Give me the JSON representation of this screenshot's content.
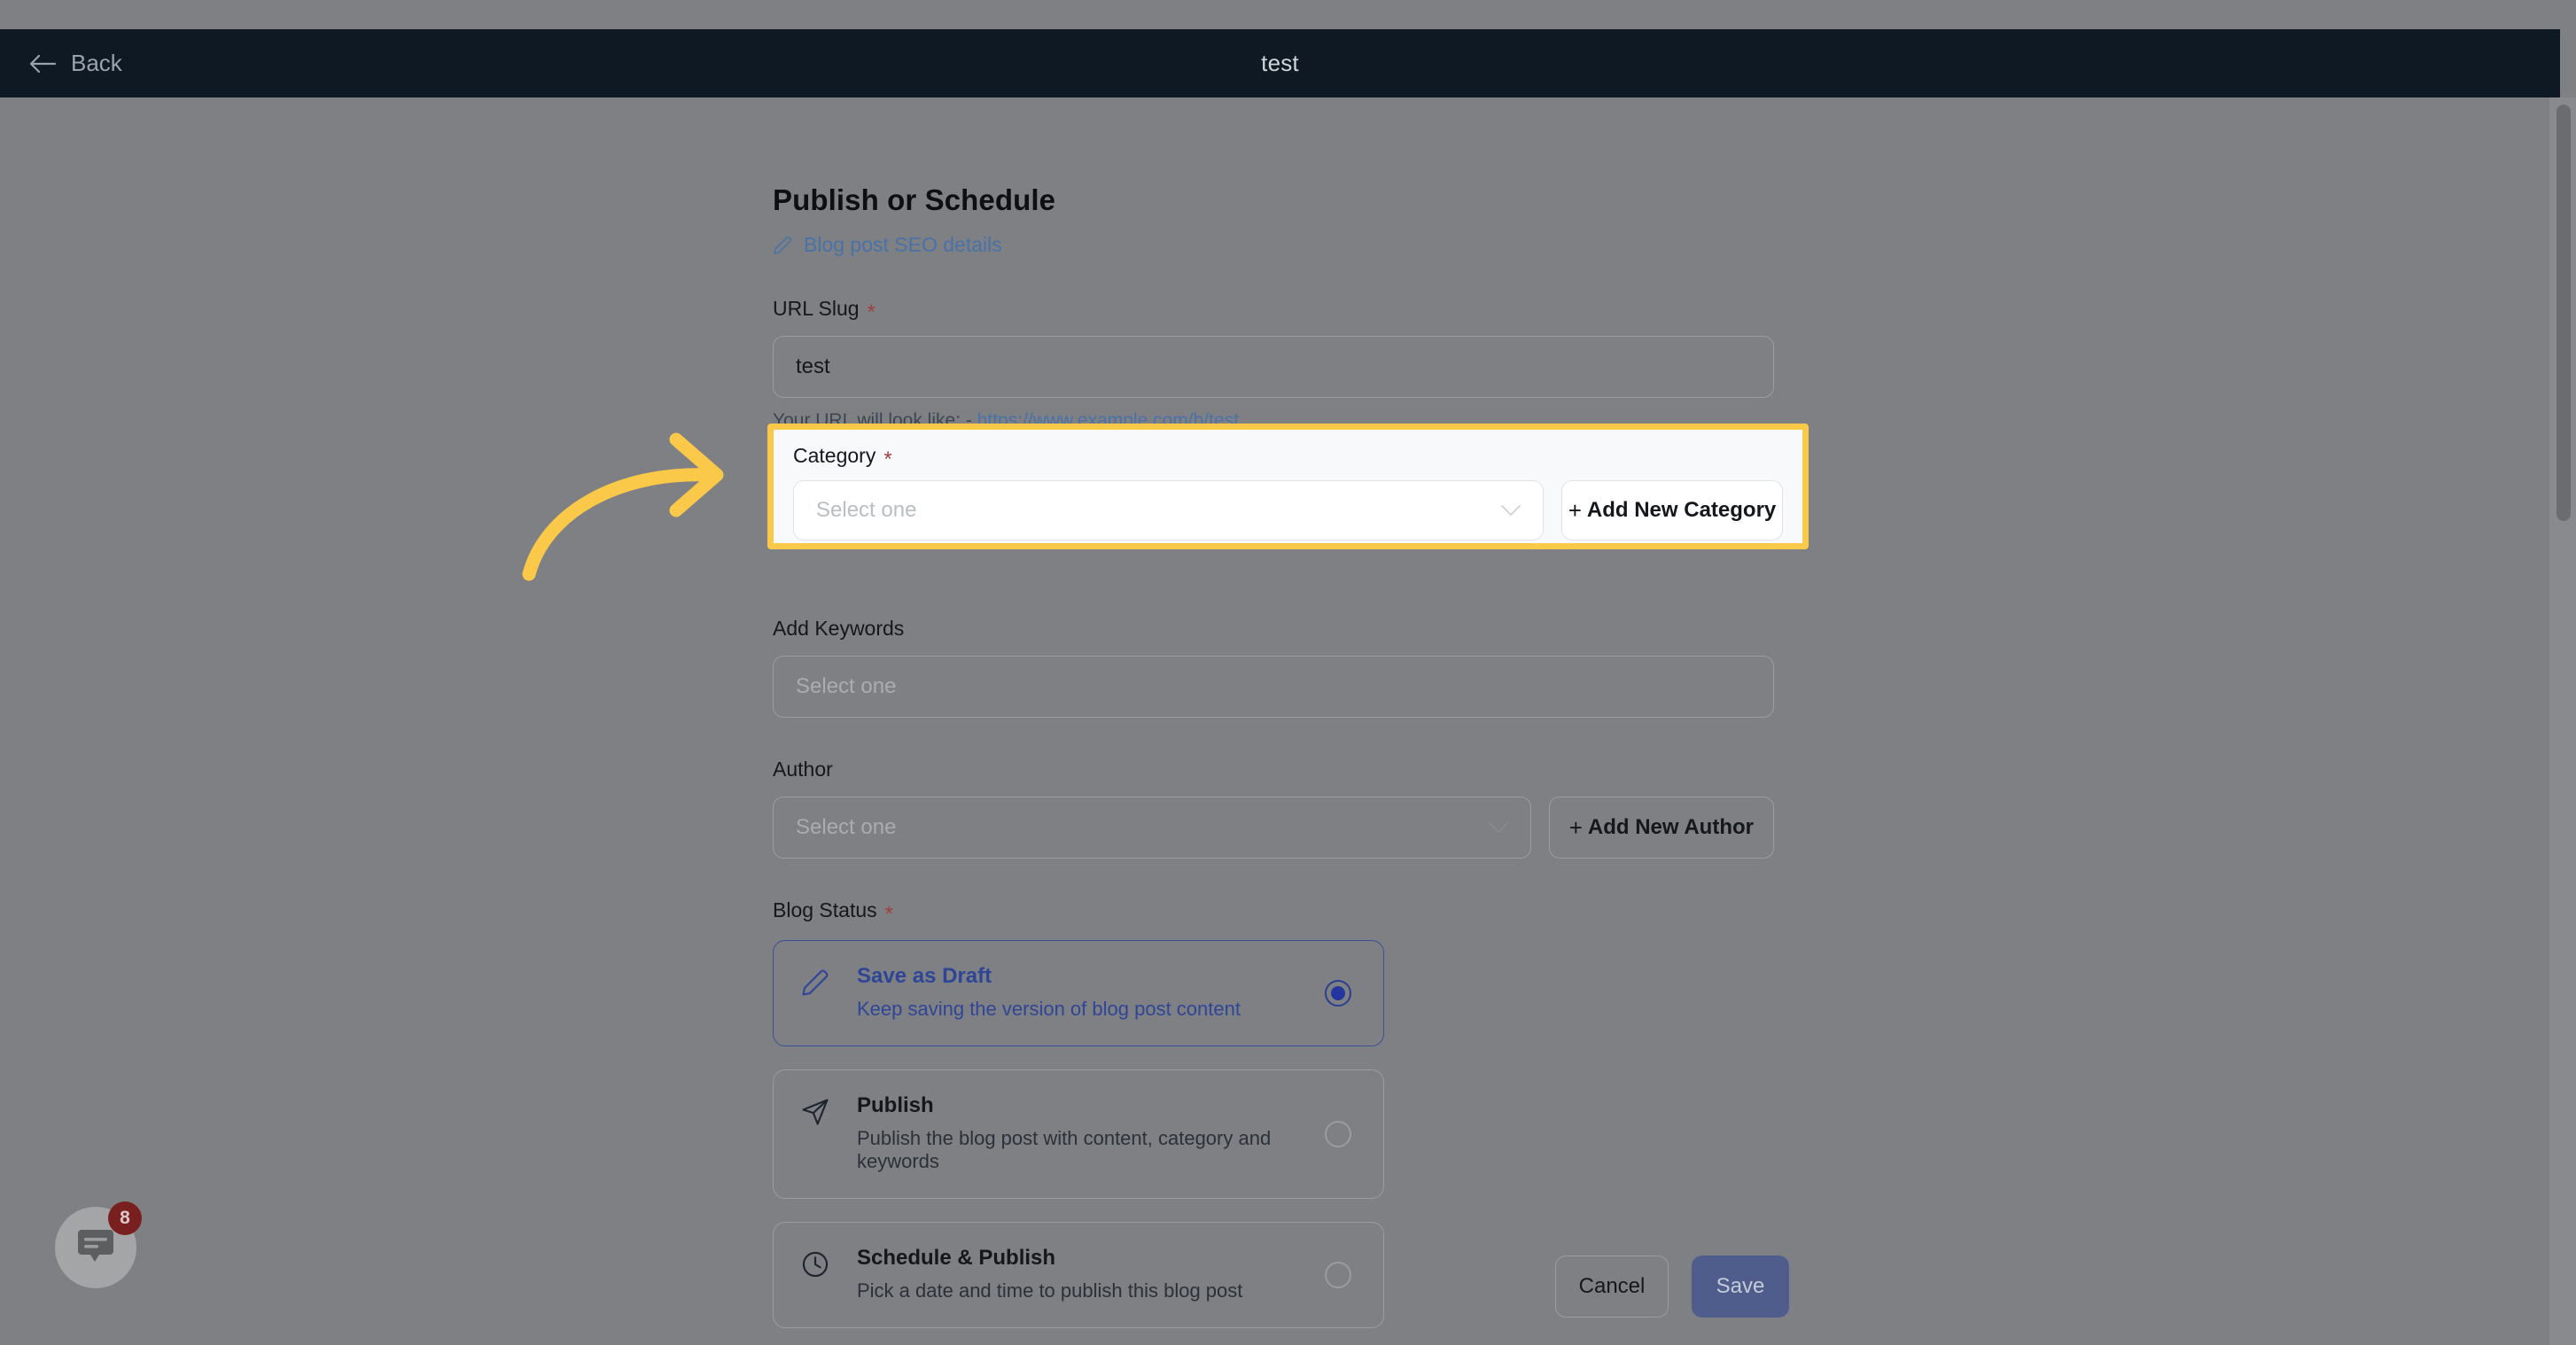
{
  "topbar": {
    "back_label": "Back",
    "title": "test"
  },
  "page": {
    "heading": "Publish or Schedule",
    "seo_link": "Blog post SEO details"
  },
  "url_slug": {
    "label": "URL Slug",
    "required_mark": "*",
    "value": "test",
    "helper_prefix": "Your URL will look like: - ",
    "helper_url": "https://www.example.com/b/test"
  },
  "category": {
    "label": "Category",
    "required_mark": "*",
    "placeholder": "Select one",
    "add_button": "Add New Category",
    "plus": "+",
    "highlighted": true
  },
  "keywords": {
    "label": "Add Keywords",
    "placeholder": "Select one"
  },
  "author": {
    "label": "Author",
    "placeholder": "Select one",
    "add_button": "Add New Author",
    "plus": "+"
  },
  "blog_status": {
    "label": "Blog Status",
    "required_mark": "*",
    "options": [
      {
        "icon": "pencil-icon",
        "title": "Save as Draft",
        "description": "Keep saving the version of blog post content",
        "selected": true
      },
      {
        "icon": "paper-plane-icon",
        "title": "Publish",
        "description": "Publish the blog post with content, category and keywords",
        "selected": false
      },
      {
        "icon": "clock-icon",
        "title": "Schedule & Publish",
        "description": "Pick a date and time to publish this blog post",
        "selected": false
      }
    ]
  },
  "footer": {
    "cancel_label": "Cancel",
    "save_label": "Save"
  },
  "chat_widget": {
    "icon": "chat-bubble-icon",
    "badge_count": "8"
  },
  "colors": {
    "highlight_yellow": "#fbc94a",
    "accent_blue": "#2f4597",
    "link_blue": "#4a71a8",
    "topbar_dark": "#0f1923",
    "overlay_gray": "#7e8083",
    "save_button": "#4e5d8c",
    "badge_red": "#7a1f1f"
  }
}
